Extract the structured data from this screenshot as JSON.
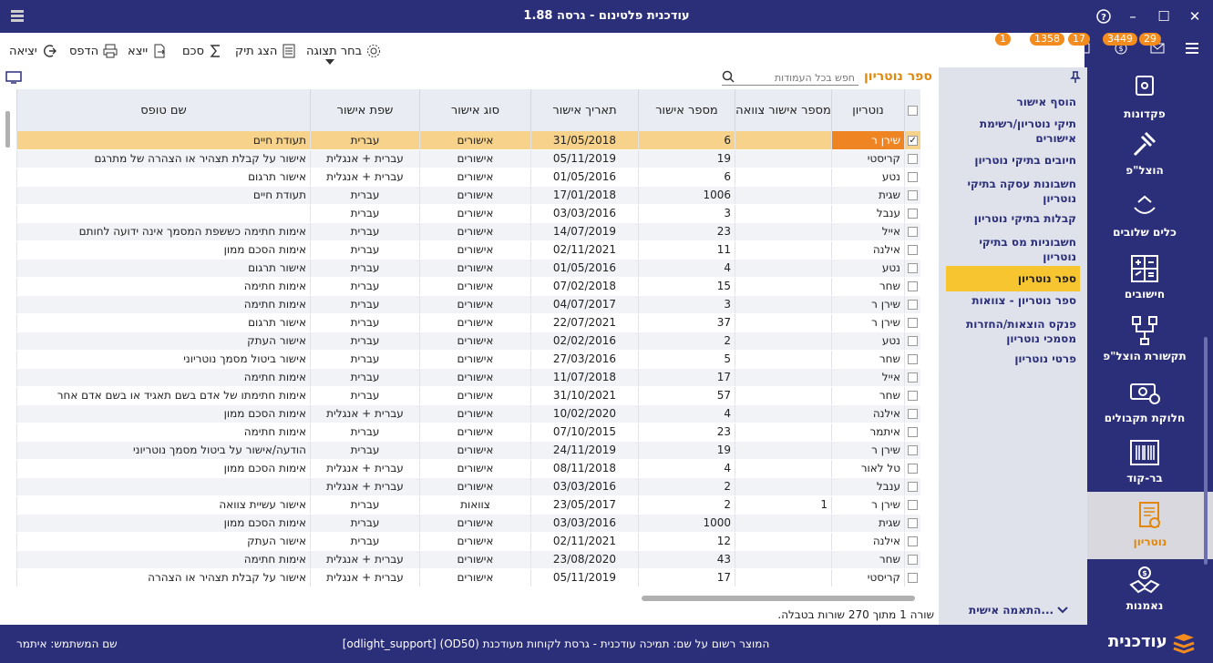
{
  "window": {
    "title": "עודכנית פלטינום - גרסה 1.88",
    "help": "?",
    "minimize": "–",
    "maximize": "☐",
    "close": "✕"
  },
  "toolbar": {
    "exit": "יציאה",
    "print": "הדפס",
    "export": "ייצא",
    "sum": "סכם",
    "show_file": "הצג תיק",
    "choose_view": "בחר תצוגה"
  },
  "badges": [
    "1",
    "1358",
    "17",
    "3449",
    "29"
  ],
  "nav": {
    "items": [
      {
        "label": "פקדונות",
        "icon": "deposit-icon"
      },
      {
        "label": "הוצל\"פ",
        "icon": "gavel-icon"
      },
      {
        "label": "כלים שלובים",
        "icon": "tools-icon"
      },
      {
        "label": "חישובים",
        "icon": "calculator-icon"
      },
      {
        "label": "תקשורת הוצל\"פ",
        "icon": "network-icon"
      },
      {
        "label": "חלוקת תקבולים",
        "icon": "money-icon"
      },
      {
        "label": "בר-קוד",
        "icon": "barcode-icon"
      },
      {
        "label": "נוטריון",
        "icon": "certificate-icon"
      },
      {
        "label": "נאמנות",
        "icon": "handshake-icon"
      }
    ]
  },
  "subpanel": {
    "items": [
      "הוסף אישור",
      "תיקי נוטריון/רשימת אישורים",
      "חיובים בתיקי נוטריון",
      "חשבונות עסקה בתיקי נוטריון",
      "קבלות בתיקי נוטריון",
      "חשבוניות מס בתיקי נוטריון",
      "ספר נוטריון",
      "ספר נוטריון - צוואות",
      "פנקס הוצאות/החזרות מסמכי נוטריון",
      "פרטי נוטריון"
    ],
    "personal": "התאמה אישית..."
  },
  "content": {
    "title": "ספר נוטריון",
    "search_placeholder": "חפש בכל העמודות",
    "row_count": "שורה 1 מתוך 270 שורות בטבלה."
  },
  "table": {
    "headers": [
      "נוטריון",
      "מספר אישור צוואה",
      "מספר אישור",
      "תאריך אישור",
      "סוג אישור",
      "שפת אישור",
      "שם טופס"
    ],
    "rows": [
      [
        "שירן ר",
        "",
        "6",
        "31/05/2018",
        "אישורים",
        "עברית",
        "תעודת חיים"
      ],
      [
        "קריסטי",
        "",
        "19",
        "05/11/2019",
        "אישורים",
        "עברית + אנגלית",
        "אישור על קבלת תצהיר או הצהרה של מתרגם"
      ],
      [
        "נטע",
        "",
        "6",
        "01/05/2016",
        "אישורים",
        "עברית + אנגלית",
        "אישור תרגום"
      ],
      [
        "שגית",
        "",
        "1006",
        "17/01/2018",
        "אישורים",
        "עברית",
        "תעודת חיים"
      ],
      [
        "ענבל",
        "",
        "3",
        "03/03/2016",
        "אישורים",
        "עברית",
        ""
      ],
      [
        "אייל",
        "",
        "23",
        "14/07/2019",
        "אישורים",
        "עברית",
        "אימות חתימה כששפת המסמך אינה ידועה לחותם"
      ],
      [
        "אילנה",
        "",
        "11",
        "02/11/2021",
        "אישורים",
        "עברית",
        "אימות הסכם ממון"
      ],
      [
        "נטע",
        "",
        "4",
        "01/05/2016",
        "אישורים",
        "עברית",
        "אישור תרגום"
      ],
      [
        "שחר",
        "",
        "15",
        "07/02/2018",
        "אישורים",
        "עברית",
        "אימות חתימה"
      ],
      [
        "שירן ר",
        "",
        "3",
        "04/07/2017",
        "אישורים",
        "עברית",
        "אימות חתימה"
      ],
      [
        "שירן ר",
        "",
        "37",
        "22/07/2021",
        "אישורים",
        "עברית",
        "אישור תרגום"
      ],
      [
        "נטע",
        "",
        "2",
        "02/02/2016",
        "אישורים",
        "עברית",
        "אישור העתק"
      ],
      [
        "שחר",
        "",
        "5",
        "27/03/2016",
        "אישורים",
        "עברית",
        "אישור ביטול מסמך נוטריוני"
      ],
      [
        "אייל",
        "",
        "17",
        "11/07/2018",
        "אישורים",
        "עברית",
        "אימות חתימה"
      ],
      [
        "שחר",
        "",
        "57",
        "31/10/2021",
        "אישורים",
        "עברית",
        "אימות חתימתו של אדם בשם תאגיד או בשם אדם אחר"
      ],
      [
        "אילנה",
        "",
        "4",
        "10/02/2020",
        "אישורים",
        "עברית + אנגלית",
        "אימות הסכם ממון"
      ],
      [
        "איתמר",
        "",
        "23",
        "07/10/2015",
        "אישורים",
        "עברית",
        "אימות חתימה"
      ],
      [
        "שירן ר",
        "",
        "19",
        "24/11/2019",
        "אישורים",
        "עברית",
        "הודעה/אישור על ביטול מסמך נוטריוני"
      ],
      [
        "טל לאור",
        "",
        "4",
        "08/11/2018",
        "אישורים",
        "עברית + אנגלית",
        "אימות הסכם ממון"
      ],
      [
        "ענבל",
        "",
        "2",
        "03/03/2016",
        "אישורים",
        "עברית + אנגלית",
        ""
      ],
      [
        "שירן ר",
        "1",
        "2",
        "23/05/2017",
        "צוואות",
        "עברית",
        "אישור עשיית צוואה"
      ],
      [
        "שגית",
        "",
        "1000",
        "03/03/2016",
        "אישורים",
        "עברית",
        "אימות הסכם ממון"
      ],
      [
        "אילנה",
        "",
        "12",
        "02/11/2021",
        "אישורים",
        "עברית",
        "אישור העתק"
      ],
      [
        "שחר",
        "",
        "43",
        "23/08/2020",
        "אישורים",
        "עברית + אנגלית",
        "אימות חתימה"
      ],
      [
        "קריסטי",
        "",
        "17",
        "05/11/2019",
        "אישורים",
        "עברית + אנגלית",
        "אישור על קבלת תצהיר או הצהרה"
      ]
    ]
  },
  "status": {
    "user": "שם המשתמש: איתמר",
    "product": "המוצר רשום על שם: תמיכה עודכנית - גרסת לקוחות מעודכנת (OD50) [odlight_support]",
    "brand": "עודכנית"
  }
}
